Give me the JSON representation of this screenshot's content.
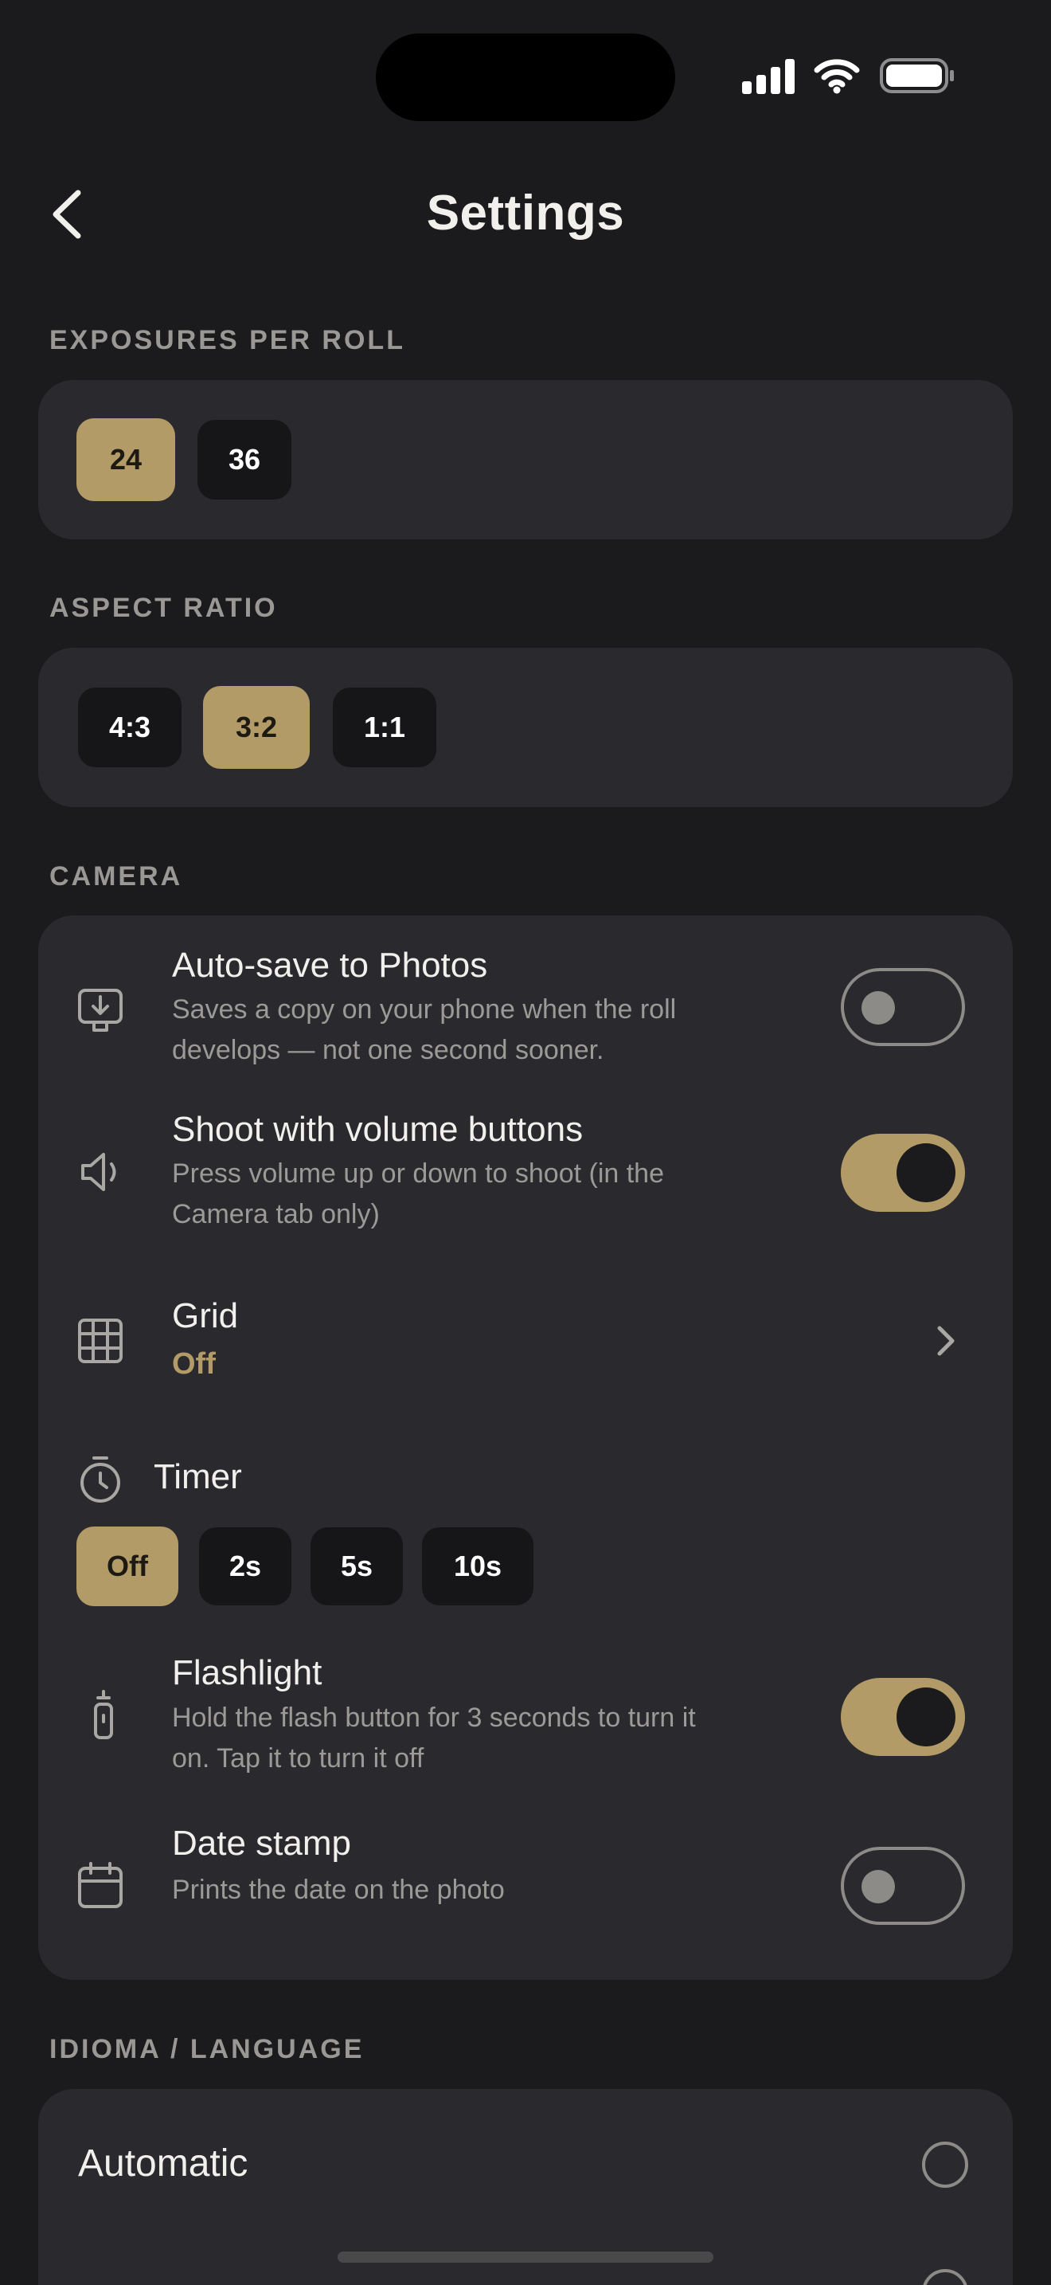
{
  "header": {
    "title": "Settings"
  },
  "exposures": {
    "label": "EXPOSURES PER ROLL",
    "options": [
      "24",
      "36"
    ],
    "selected": "24"
  },
  "aspect": {
    "label": "ASPECT RATIO",
    "options": [
      "4:3",
      "3:2",
      "1:1"
    ],
    "selected": "3:2"
  },
  "camera": {
    "label": "CAMERA",
    "autosave": {
      "title": "Auto-save to Photos",
      "subtitle_1": "Saves a copy on your phone when the roll",
      "subtitle_2": "develops — not one second sooner.",
      "enabled": false
    },
    "volume": {
      "title": "Shoot with volume buttons",
      "subtitle_1": "Press volume up or down to shoot (in the",
      "subtitle_2": "Camera tab only)",
      "enabled": true
    },
    "grid": {
      "title": "Grid",
      "value": "Off"
    },
    "timer": {
      "title": "Timer",
      "options": [
        "Off",
        "2s",
        "5s",
        "10s"
      ],
      "selected": "Off"
    },
    "flashlight": {
      "title": "Flashlight",
      "subtitle_1": "Hold the flash button for 3 seconds to turn it",
      "subtitle_2": "on. Tap it to turn it off",
      "enabled": true
    },
    "datestamp": {
      "title": "Date stamp",
      "subtitle_1": "Prints the date on the photo",
      "enabled": false
    }
  },
  "language": {
    "label": "IDIOMA / LANGUAGE",
    "options": [
      "Automatic"
    ]
  },
  "colors": {
    "accent": "#b39b67",
    "background": "#1b1b1d",
    "card": "#2a2a2e",
    "chip": "#161618"
  }
}
